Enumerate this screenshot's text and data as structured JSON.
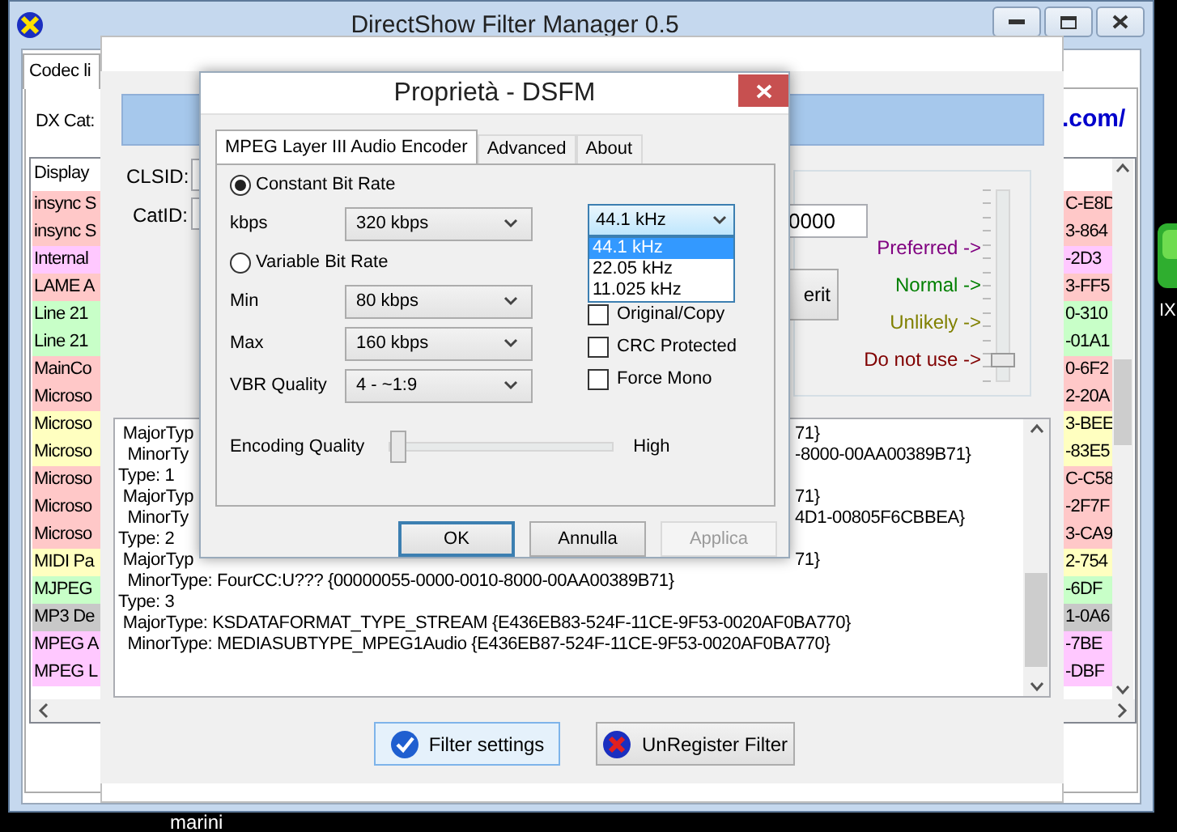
{
  "desktop": {
    "icon_label": "IX",
    "bottom_label": "marini"
  },
  "main_window": {
    "title": "DirectShow Filter Manager 0.5",
    "tab": "Codec li",
    "dx_label": "DX Cat:",
    "link": ".com/",
    "list_header": "Display",
    "rows": [
      {
        "left": "insync S",
        "right": "C-E8D",
        "color": "#ffc8c8"
      },
      {
        "left": "insync S",
        "right": "3-864",
        "color": "#ffc8c8"
      },
      {
        "left": "Internal",
        "right": "-2D3",
        "color": "#ffc8ff"
      },
      {
        "left": "LAME A",
        "right": "3-FF5",
        "color": "#ffc8c8"
      },
      {
        "left": "Line 21",
        "right": "0-310",
        "color": "#c8ffc8"
      },
      {
        "left": "Line 21",
        "right": "-01A1",
        "color": "#c8ffc8"
      },
      {
        "left": "MainCo",
        "right": "0-6F2",
        "color": "#ffc8c8"
      },
      {
        "left": "Microso",
        "right": "2-20A",
        "color": "#ffc8c8"
      },
      {
        "left": "Microso",
        "right": "3-BEE",
        "color": "#ffffc0"
      },
      {
        "left": "Microso",
        "right": "-83E5",
        "color": "#ffffc0"
      },
      {
        "left": "Microso",
        "right": "C-C58",
        "color": "#ffc8c8"
      },
      {
        "left": "Microso",
        "right": "-2F7F",
        "color": "#ffc8c8"
      },
      {
        "left": "Microso",
        "right": "3-CA9",
        "color": "#ffc8c8"
      },
      {
        "left": "MIDI Pa",
        "right": "2-754",
        "color": "#ffffc0"
      },
      {
        "left": "MJPEG",
        "right": "-6DF",
        "color": "#c8ffc8"
      },
      {
        "left": "MP3 De",
        "right": "1-0A6",
        "color": "#c8c8c8"
      },
      {
        "left": "MPEG A",
        "right": "-7BE",
        "color": "#ffc8ff"
      },
      {
        "left": "MPEG L",
        "right": "-DBF",
        "color": "#ffc8ff"
      }
    ]
  },
  "filter_window": {
    "clsid_label": "CLSID:",
    "catid_label": "CatID:",
    "field_value": "0000",
    "merit_button": "erit",
    "merit_levels": [
      {
        "label": "Preferred ->",
        "color": "#800080"
      },
      {
        "label": "Normal ->",
        "color": "#008000"
      },
      {
        "label": "Unlikely ->",
        "color": "#808000"
      },
      {
        "label": "Do not use ->",
        "color": "#800000"
      }
    ],
    "merit_slider": {
      "level": 0.1
    },
    "media_types": [
      {
        "left": " MajorTyp",
        "right": "71}"
      },
      {
        "left": "  MinorTy",
        "right": "-8000-00AA00389B71}"
      },
      {
        "text": "Type: 1"
      },
      {
        "left": " MajorTyp",
        "right": "71}"
      },
      {
        "left": "  MinorTy",
        "right": "4D1-00805F6CBBEA}"
      },
      {
        "text": "Type: 2"
      },
      {
        "left": " MajorTyp",
        "right": "71}"
      },
      {
        "text": "  MinorType: FourCC:U??? {00000055-0000-0010-8000-00AA00389B71}"
      },
      {
        "text": "Type: 3"
      },
      {
        "text": " MajorType: KSDATAFORMAT_TYPE_STREAM {E436EB83-524F-11CE-9F53-0020AF0BA770}"
      },
      {
        "text": "  MinorType: MEDIASUBTYPE_MPEG1Audio {E436EB87-524F-11CE-9F53-0020AF0BA770}"
      }
    ],
    "buttons": [
      {
        "label": "Filter settings",
        "kind": "confirm"
      },
      {
        "label": "UnRegister Filter",
        "kind": "remove"
      }
    ]
  },
  "dialog": {
    "title": "Proprietà - DSFM",
    "tabs": [
      {
        "label": "MPEG Layer III Audio Encoder",
        "selected": true
      },
      {
        "label": "Advanced",
        "selected": false
      },
      {
        "label": "About",
        "selected": false
      }
    ],
    "rows": [
      {
        "kind": "radio",
        "label": "Constant Bit Rate",
        "selected": true
      },
      {
        "kind": "select",
        "label": "kbps",
        "value": "320 kbps"
      },
      {
        "kind": "radio",
        "label": "Variable Bit Rate",
        "selected": false
      },
      {
        "kind": "select",
        "label": "Min",
        "value": "80 kbps"
      },
      {
        "kind": "select",
        "label": "Max",
        "value": "160 kbps"
      },
      {
        "kind": "select",
        "label": "VBR Quality",
        "value": "4 - ~1:9"
      }
    ],
    "sample_rate": {
      "value": "44.1 kHz",
      "options": [
        {
          "label": "44.1 kHz",
          "selected": true
        },
        {
          "label": "22.05 kHz",
          "selected": false
        },
        {
          "label": "11.025 kHz",
          "selected": false
        }
      ]
    },
    "checkboxes": [
      {
        "label": "Original/Copy",
        "checked": false
      },
      {
        "label": "CRC Protected",
        "checked": false
      },
      {
        "label": "Force Mono",
        "checked": false
      }
    ],
    "encoding_quality": {
      "label": "Encoding Quality",
      "level": 0,
      "end_label": "High"
    },
    "buttons": [
      {
        "label": "OK",
        "default": true,
        "disabled": false
      },
      {
        "label": "Annulla",
        "default": false,
        "disabled": false
      },
      {
        "label": "Applica",
        "default": false,
        "disabled": true
      }
    ]
  }
}
